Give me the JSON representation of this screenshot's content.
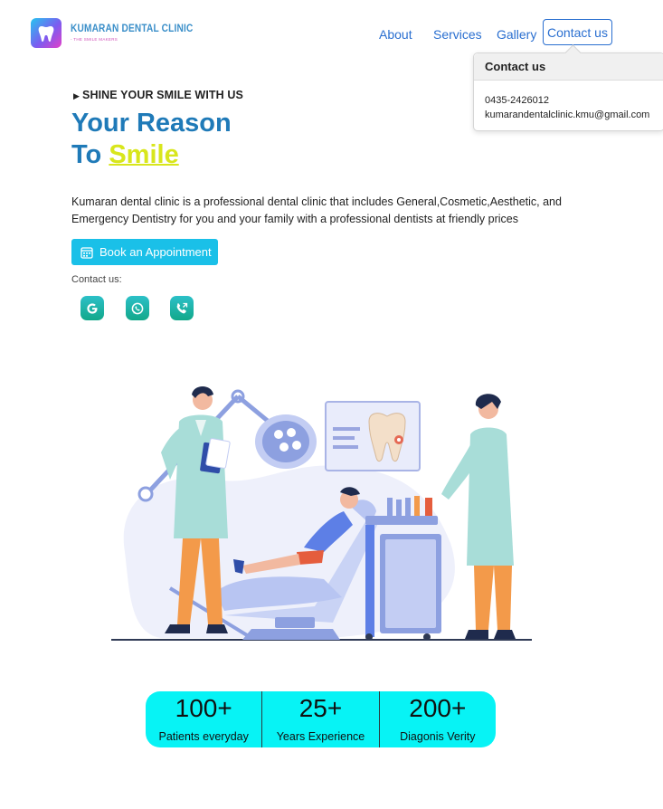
{
  "brand": {
    "name": "KUMARAN DENTAL CLINIC",
    "tagline": "- THE SMILE MAKERS"
  },
  "nav": {
    "about": "About",
    "services": "Services",
    "gallery": "Gallery",
    "contact": "Contact us"
  },
  "popover": {
    "title": "Contact us",
    "phone": "0435-2426012",
    "email": "kumarandentalclinic.kmu@gmail.com"
  },
  "hero": {
    "eyebrow": "SHINE YOUR SMILE WITH US",
    "title_line1": "Your Reason",
    "title_to": "To ",
    "title_highlight": "Smile",
    "description": "Kumaran dental clinic is a professional dental clinic that includes General,Cosmetic,Aesthetic, and Emergency Dentistry for you and your family with a professional dentists at friendly prices",
    "cta": "Book an Appointment",
    "contact_label": "Contact us:"
  },
  "social": [
    {
      "name": "google-icon",
      "color": "#1bb8a6"
    },
    {
      "name": "whatsapp-icon",
      "color": "#1bb8a6"
    },
    {
      "name": "phone-icon",
      "color": "#1bb8a6"
    }
  ],
  "stats": [
    {
      "value": "100+",
      "label": "Patients everyday"
    },
    {
      "value": "25+",
      "label": "Years Experience"
    },
    {
      "value": "200+",
      "label": "Diagonis Verity"
    }
  ],
  "colors": {
    "accent": "#1f7ab8",
    "highlight": "#d8e61c",
    "button": "#1ac0e8",
    "stats_bg": "#07f3f5",
    "nav_link": "#2a6fd0"
  }
}
